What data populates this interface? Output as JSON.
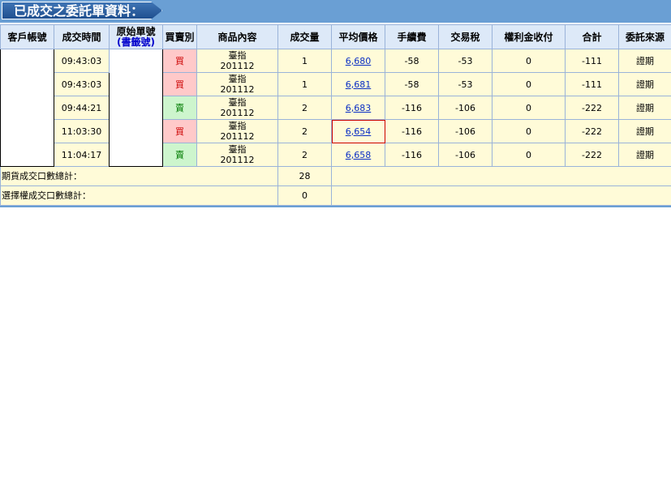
{
  "title": "已成交之委託單資料：",
  "columns": {
    "account": "客戶帳號",
    "time": "成交時間",
    "orig_order_top": "原始單號",
    "orig_order_link": "(書籤號)",
    "side": "買賣別",
    "product": "商品內容",
    "qty": "成交量",
    "avg_price": "平均價格",
    "fee": "手續費",
    "tax": "交易稅",
    "premium": "權利金收付",
    "total": "合計",
    "source": "委託來源"
  },
  "rows": [
    {
      "time": "09:43:03",
      "side": "買",
      "side_type": "buy",
      "product_name": "臺指",
      "product_month": "201112",
      "qty": "1",
      "price": "6,680",
      "fee": "-58",
      "tax": "-53",
      "premium": "0",
      "total": "-111",
      "source": "證期"
    },
    {
      "time": "09:43:03",
      "side": "買",
      "side_type": "buy",
      "product_name": "臺指",
      "product_month": "201112",
      "qty": "1",
      "price": "6,681",
      "fee": "-58",
      "tax": "-53",
      "premium": "0",
      "total": "-111",
      "source": "證期"
    },
    {
      "time": "09:44:21",
      "side": "賣",
      "side_type": "sell",
      "product_name": "臺指",
      "product_month": "201112",
      "qty": "2",
      "price": "6,683",
      "fee": "-116",
      "tax": "-106",
      "premium": "0",
      "total": "-222",
      "source": "證期"
    },
    {
      "time": "11:03:30",
      "side": "買",
      "side_type": "buy",
      "product_name": "臺指",
      "product_month": "201112",
      "qty": "2",
      "price": "6,654",
      "fee": "-116",
      "tax": "-106",
      "premium": "0",
      "total": "-222",
      "source": "證期"
    },
    {
      "time": "11:04:17",
      "side": "賣",
      "side_type": "sell",
      "product_name": "臺指",
      "product_month": "201112",
      "qty": "2",
      "price": "6,658",
      "fee": "-116",
      "tax": "-106",
      "premium": "0",
      "total": "-222",
      "source": "證期"
    }
  ],
  "summary": {
    "futures_label": "期貨成交口數總計：",
    "futures_total": "28",
    "options_label": "選擇權成交口數總計：",
    "options_total": "0"
  },
  "colors": {
    "header_bar": "#6a9fd4",
    "row_bg": "#fffbd8",
    "buy_bg": "#ffc9c9",
    "sell_bg": "#cdf5cd"
  }
}
